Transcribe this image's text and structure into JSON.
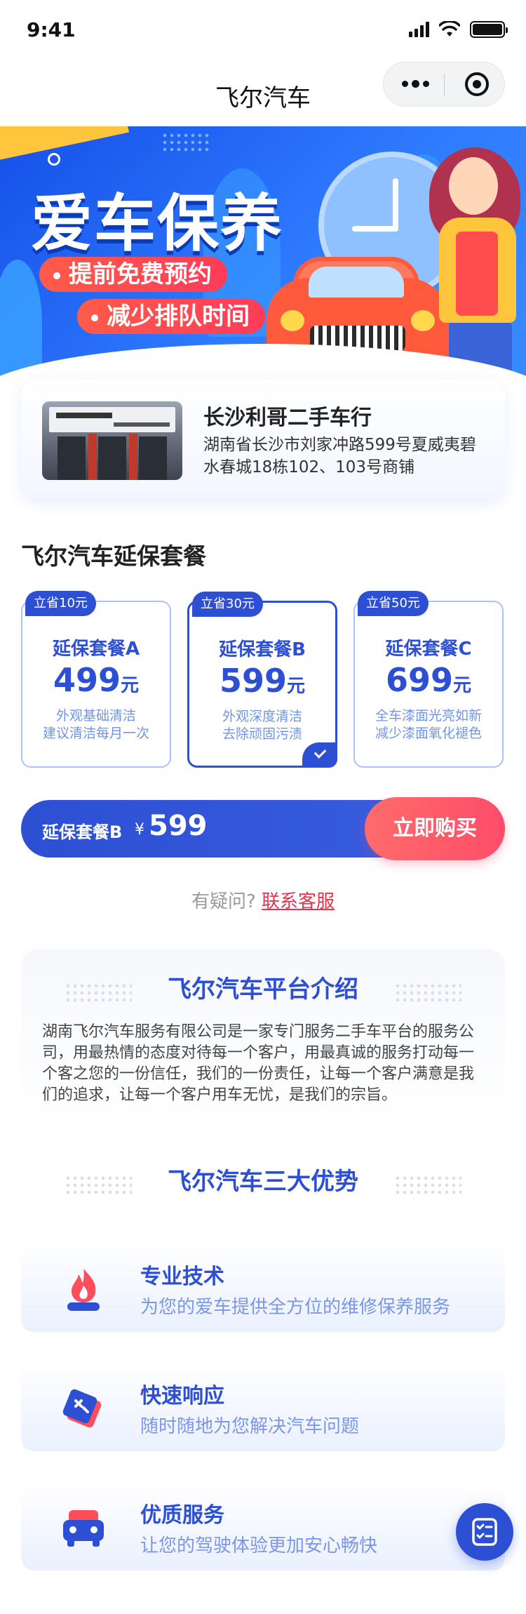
{
  "status_bar": {
    "time": "9:41"
  },
  "nav": {
    "title": "飞尔汽车"
  },
  "banner": {
    "title": "爱车保养",
    "points": [
      "提前免费预约",
      "减少排队时间"
    ]
  },
  "store": {
    "name": "长沙利哥二手车行",
    "address": "湖南省长沙市刘家冲路599号夏威夷碧水春城18栋102、103号商铺"
  },
  "packages_section": {
    "title": "飞尔汽车延保套餐",
    "packages": [
      {
        "tag": "立省10元",
        "name": "延保套餐A",
        "price": "499",
        "unit": "元",
        "desc_1": "外观基础清洁",
        "desc_2": "建议清洁每月一次",
        "selected": false
      },
      {
        "tag": "立省30元",
        "name": "延保套餐B",
        "price": "599",
        "unit": "元",
        "desc_1": "外观深度清洁",
        "desc_2": "去除顽固污渍",
        "selected": true
      },
      {
        "tag": "立省50元",
        "name": "延保套餐C",
        "price": "699",
        "unit": "元",
        "desc_1": "全车漆面光亮如新",
        "desc_2": "减少漆面氧化褪色",
        "selected": false
      }
    ]
  },
  "buy_bar": {
    "selected_label": "延保套餐B",
    "currency": "¥",
    "amount": "599",
    "button_label": "立即购买"
  },
  "help": {
    "text": "有疑问?",
    "link": "联系客服"
  },
  "intro": {
    "title": "飞尔汽车平台介绍",
    "body": "湖南飞尔汽车服务有限公司是一家专门服务二手车平台的服务公司，用最热情的态度对待每一个客户，用最真诚的服务打动每一个客之您的一份信任，我们的一份责任，让每一个客户满意是我们的追求，让每一个客户用车无忧，是我们的宗旨。"
  },
  "advantages": {
    "title": "飞尔汽车三大优势",
    "items": [
      {
        "icon": "flame-icon",
        "title": "专业技术",
        "desc": "为您的爱车提供全方位的维修保养服务"
      },
      {
        "icon": "tag-icon",
        "title": "快速响应",
        "desc": "随时随地为您解决汽车问题"
      },
      {
        "icon": "car-icon",
        "title": "优质服务",
        "desc": "让您的驾驶体验更加安心畅快"
      }
    ]
  },
  "colors": {
    "primary": "#2c4fd4",
    "accent_red": "#ff4d6a",
    "link_red": "#e8334a",
    "muted_blue": "#7c97e6"
  },
  "float_button": {
    "icon": "service-checklist-icon"
  }
}
